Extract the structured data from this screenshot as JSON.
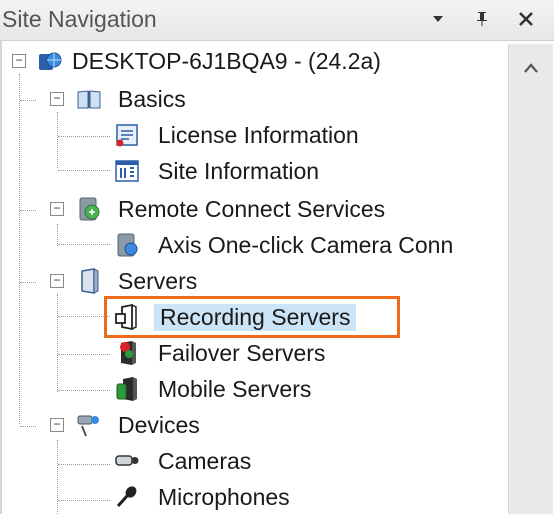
{
  "panel": {
    "title": "Site Navigation",
    "buttons": {
      "dropdown": "▾",
      "pin": "ᵖ",
      "close": "✕"
    }
  },
  "tree": {
    "root": {
      "label": "DESKTOP-6J1BQA9 - (24.2a)",
      "expander": "−",
      "icon": "server-globe-icon"
    },
    "basics": {
      "label": "Basics",
      "expander": "−",
      "icon": "book-icon"
    },
    "license": {
      "label": "License Information",
      "icon": "license-icon"
    },
    "site_info": {
      "label": "Site Information",
      "icon": "info-icon"
    },
    "remote": {
      "label": "Remote Connect Services",
      "expander": "−",
      "icon": "remote-connect-icon"
    },
    "axis": {
      "label": "Axis One-click Camera Conn",
      "icon": "axis-camera-icon"
    },
    "servers": {
      "label": "Servers",
      "expander": "−",
      "icon": "servers-icon"
    },
    "recording": {
      "label": "Recording Servers",
      "icon": "recording-server-icon",
      "selected": true
    },
    "failover": {
      "label": "Failover Servers",
      "icon": "failover-server-icon"
    },
    "mobile": {
      "label": "Mobile Servers",
      "icon": "mobile-server-icon"
    },
    "devices": {
      "label": "Devices",
      "expander": "−",
      "icon": "devices-icon"
    },
    "cameras": {
      "label": "Cameras",
      "icon": "camera-icon"
    },
    "microphones": {
      "label": "Microphones",
      "icon": "microphone-icon"
    }
  },
  "scrollbar": {
    "up_arrow": "^"
  },
  "colors": {
    "highlight": "#f06a1c",
    "selection": "#cce4f7"
  }
}
